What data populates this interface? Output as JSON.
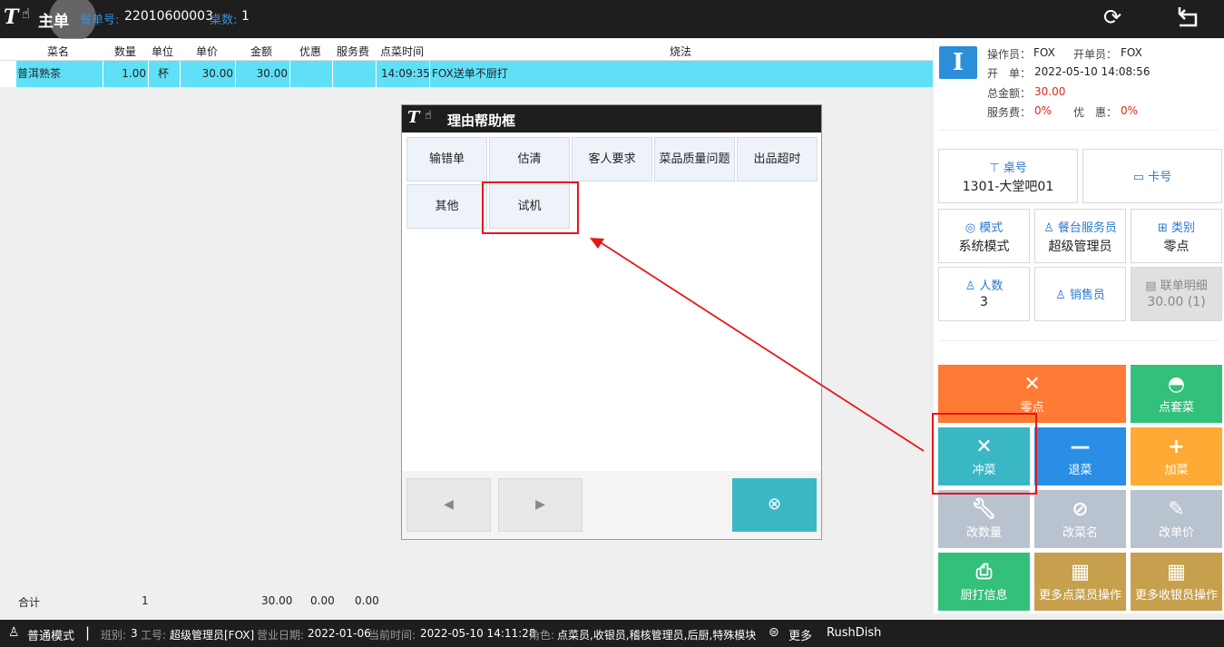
{
  "topbar": {
    "logo": "T",
    "title": "主单",
    "order_no_label": "餐单号:",
    "order_no": "22010600003",
    "table_count_label": "桌数:",
    "table_count": "1"
  },
  "order_table": {
    "headers": [
      "菜名",
      "数量",
      "单位",
      "单价",
      "金额",
      "优惠",
      "服务费",
      "点菜时间",
      "烧法"
    ],
    "rows": [
      {
        "name": "普洱熟茶",
        "qty": "1.00",
        "unit": "杯",
        "price": "30.00",
        "amount": "30.00",
        "discount": "",
        "service": "",
        "time": "14:09:35",
        "method": "FOX送单不厨打"
      }
    ],
    "footer": {
      "label": "合计",
      "qty": "1",
      "amount": "30.00",
      "discount": "0.00",
      "service": "0.00"
    }
  },
  "modal": {
    "logo": "T",
    "title": "理由帮助框",
    "reasons": [
      "输错单",
      "估清",
      "客人要求",
      "菜品质量问题",
      "出品超时",
      "其他",
      "试机"
    ],
    "prev_symbol": "◀",
    "next_symbol": "▶",
    "close_symbol": "⊗"
  },
  "info": {
    "operator_label": "操作员：",
    "operator": "FOX",
    "opener_label": "开单员：",
    "opener": "FOX",
    "open_time_label": "开　单：",
    "open_time": "2022-05-10 14:08:56",
    "total_label": "总金额：",
    "total": "30.00",
    "service_label": "服务费：",
    "service": "0%",
    "discount_label": "优　惠：",
    "discount": "0%"
  },
  "cards": {
    "table": {
      "label": "桌号",
      "value": "1301-大堂吧01"
    },
    "card_no": {
      "label": "卡号"
    },
    "mode": {
      "label": "模式",
      "value": "系统模式"
    },
    "waiter": {
      "label": "餐台服务员",
      "value": "超级管理员"
    },
    "category": {
      "label": "类别",
      "value": "零点"
    },
    "guests": {
      "label": "人数",
      "value": "3"
    },
    "salesman": {
      "label": "销售员"
    },
    "joint": {
      "label": "联单明细",
      "value": "30.00 (1)"
    }
  },
  "actions": {
    "alacarte": "零点",
    "set_meal": "点套菜",
    "cancel_dish": "冲菜",
    "return_dish": "退菜",
    "add_dish": "加菜",
    "change_qty": "改数量",
    "change_name": "改菜名",
    "change_price": "改单价",
    "kitchen_print": "厨打信息",
    "more_waiter": "更多点菜员操作",
    "more_cashier": "更多收银员操作"
  },
  "statusbar": {
    "mode": "普通模式",
    "shift_label": "班别:",
    "shift": "3",
    "staff_label": "工号:",
    "staff": "超级管理员[FOX]",
    "biz_date_label": "营业日期:",
    "biz_date": "2022-01-06",
    "now_label": "当前时间:",
    "now": "2022-05-10 14:11:28",
    "role_label": "角色:",
    "roles": "点菜员,收银员,稽核管理员,后厨,特殊模块",
    "more": "更多",
    "brand": "RushDish"
  },
  "colors": {
    "topbar": "#1e1e1e",
    "row_highlight": "#5fe0f7",
    "accent_blue": "#2b79cf",
    "annotation_red": "#e8161a"
  }
}
